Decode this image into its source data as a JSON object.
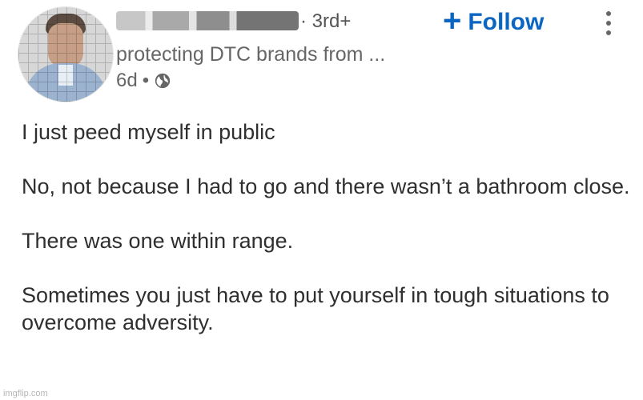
{
  "post": {
    "author": {
      "degree": "· 3rd+",
      "headline": "protecting DTC brands from ...",
      "time": "6d",
      "time_sep": "•"
    },
    "actions": {
      "follow_plus": "+",
      "follow_label": "Follow"
    },
    "body": {
      "p1": "I just peed myself in public",
      "p2": "No, not because I had to go and there wasn’t a bathroom close.",
      "p3": "There was one within range.",
      "p4": "Sometimes you just have to put yourself in tough situations to overcome adversity."
    },
    "icons": {
      "globe": "globe-icon",
      "more": "more-vertical-icon"
    },
    "colors": {
      "accent": "#0a66c2",
      "text": "#2f2f2f",
      "muted": "#666666"
    }
  },
  "watermark": {
    "text": "imgflip.com"
  }
}
